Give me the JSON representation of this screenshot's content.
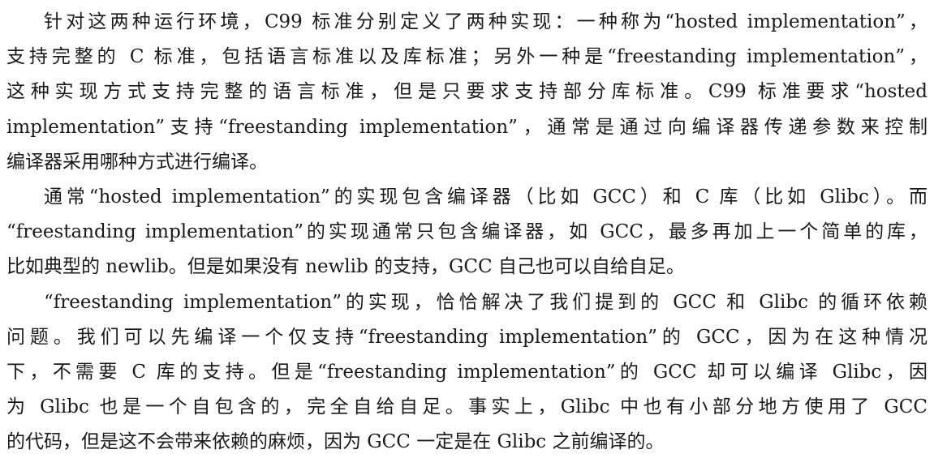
{
  "paragraphs": [
    {
      "lines": [
        "针对这两种运行环境，C99 标准分别定义了两种实现：一种称为“hosted implementation”，",
        "支持完整的 C 标准，包括语言标准以及库标准；另外一种是“freestanding implementation”，",
        "这种实现方式支持完整的语言标准，但是只要求支持部分库标准。C99 标准要求“hosted",
        "implementation”支持“freestanding implementation”，通常是通过向编译器传递参数来控制",
        "编译器采用哪种方式进行编译。"
      ]
    },
    {
      "lines": [
        "通常“hosted implementation”的实现包含编译器（比如 GCC）和 C 库（比如 Glibc）。而",
        "“freestanding implementation”的实现通常只包含编译器，如 GCC，最多再加上一个简单的库，",
        "比如典型的 newlib。但是如果没有 newlib 的支持，GCC 自己也可以自给自足。"
      ]
    },
    {
      "lines": [
        "“freestanding implementation”的实现，恰恰解决了我们提到的 GCC 和 Glibc 的循环依赖",
        "问题。我们可以先编译一个仅支持“freestanding implementation”的 GCC，因为在这种情况",
        "下，不需要 C 库的支持。但是“freestanding implementation”的 GCC 却可以编译 Glibc，因",
        "为 Glibc 也是一个自包含的，完全自给自足。事实上，Glibc 中也有小部分地方使用了 GCC",
        "的代码，但是这不会带来依赖的麻烦，因为 GCC 一定是在 Glibc 之前编译的。"
      ]
    }
  ]
}
